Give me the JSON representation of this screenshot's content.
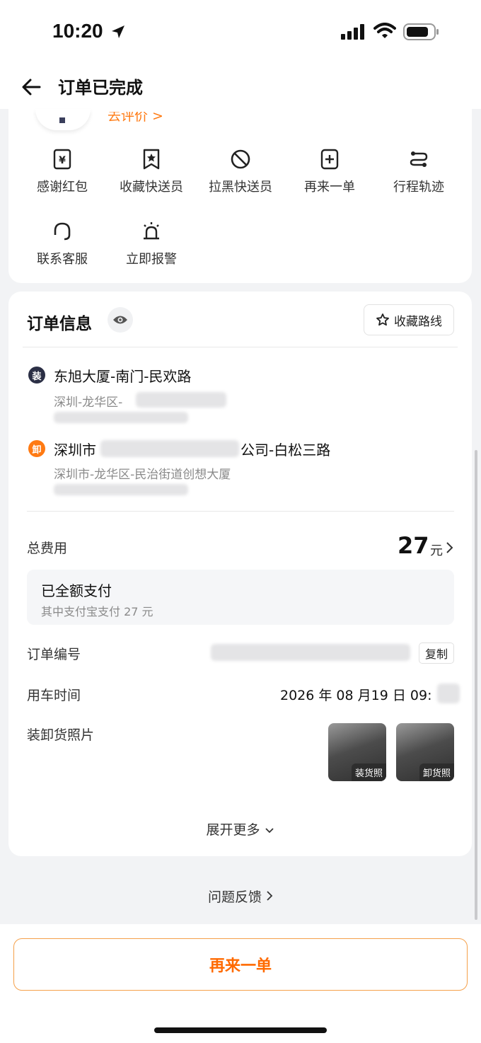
{
  "status": {
    "time": "10:20"
  },
  "nav": {
    "title": "订单已完成"
  },
  "top": {
    "review_link": "去评价 >",
    "actions": [
      {
        "label": "感谢红包",
        "icon": "red-packet-icon"
      },
      {
        "label": "收藏快送员",
        "icon": "bookmark-star-icon"
      },
      {
        "label": "拉黑快送员",
        "icon": "block-icon"
      },
      {
        "label": "再来一单",
        "icon": "plus-square-icon"
      },
      {
        "label": "行程轨迹",
        "icon": "route-icon"
      },
      {
        "label": "联系客服",
        "icon": "headset-icon"
      },
      {
        "label": "立即报警",
        "icon": "alarm-icon"
      }
    ]
  },
  "info": {
    "title": "订单信息",
    "fav_route": "收藏路线",
    "pickup": {
      "badge": "装",
      "name": "东旭大厦-南门-民欢路",
      "sub": "深圳-龙华区-"
    },
    "dropoff": {
      "badge": "卸",
      "name_prefix": "深圳市",
      "name_suffix": "公司-白松三路",
      "sub": "深圳市-龙华区-民治街道创想大厦"
    },
    "fee_label": "总费用",
    "fee_amount": "27",
    "fee_unit": "元",
    "paid_title": "已全额支付",
    "paid_sub": "其中支付宝支付 27 元",
    "order_no_label": "订单编号",
    "copy": "复制",
    "time_label": "用车时间",
    "time_value": "2026 年 08 月19 日  09:",
    "photos_label": "装卸货照片",
    "photo_tags": [
      "装货照",
      "卸货照"
    ],
    "expand": "展开更多"
  },
  "feedback": "问题反馈",
  "reorder": "再来一单",
  "colors": {
    "accent": "#ff6a00",
    "pickup_badge": "#2b2f45",
    "dropoff_badge": "#ff7a12"
  }
}
